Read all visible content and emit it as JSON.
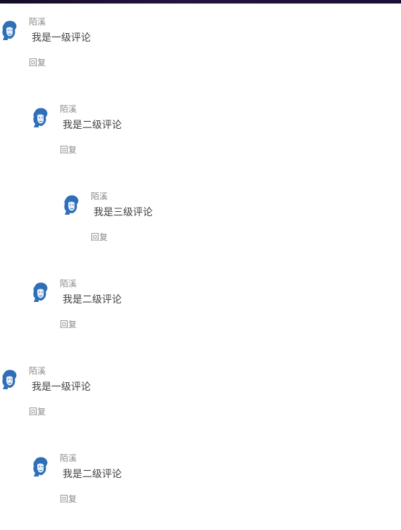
{
  "comments": [
    {
      "level": 1,
      "author": "陌溪",
      "content": "我是一级评论",
      "reply_label": "回复",
      "avatar_icon": "user-avatar-icon"
    },
    {
      "level": 2,
      "author": "陌溪",
      "content": "我是二级评论",
      "reply_label": "回复",
      "avatar_icon": "user-avatar-icon"
    },
    {
      "level": 3,
      "author": "陌溪",
      "content": "我是三级评论",
      "reply_label": "回复",
      "avatar_icon": "user-avatar-icon"
    },
    {
      "level": 2,
      "author": "陌溪",
      "content": "我是二级评论",
      "reply_label": "回复",
      "avatar_icon": "user-avatar-icon"
    },
    {
      "level": 1,
      "author": "陌溪",
      "content": "我是一级评论",
      "reply_label": "回复",
      "avatar_icon": "user-avatar-icon"
    },
    {
      "level": 2,
      "author": "陌溪",
      "content": "我是二级评论",
      "reply_label": "回复",
      "avatar_icon": "user-avatar-icon"
    }
  ],
  "colors": {
    "text_primary": "#404040",
    "text_secondary": "#8a8a8a",
    "avatar_blue": "#2f6fb8"
  }
}
